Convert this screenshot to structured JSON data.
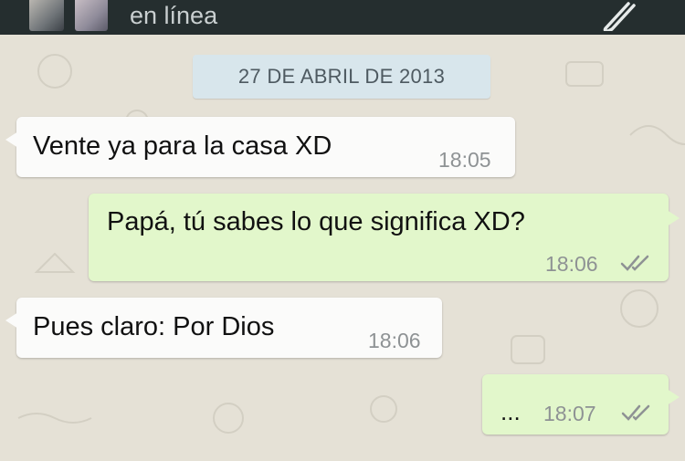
{
  "header": {
    "status": "en línea",
    "attach_icon": "paperclip-icon",
    "avatars": [
      "contact-avatar-photo",
      "contact-avatar-photo"
    ]
  },
  "chat": {
    "date_label": "27 DE ABRIL DE 2013",
    "messages": [
      {
        "direction": "incoming",
        "text": "Vente ya para la casa XD",
        "time": "18:05"
      },
      {
        "direction": "outgoing",
        "text": "Papá, tú sabes lo que significa XD?",
        "time": "18:06",
        "status_icon": "double-check-icon"
      },
      {
        "direction": "incoming",
        "text": "Pues claro: Por Dios",
        "time": "18:06"
      },
      {
        "direction": "outgoing",
        "text": "...",
        "time": "18:07",
        "status_icon": "double-check-icon"
      }
    ]
  },
  "colors": {
    "header_bg": "#252e2f",
    "wallpaper": "#e5e1d6",
    "incoming_bubble": "#fbfbfa",
    "outgoing_bubble": "#e2f7cb",
    "date_chip": "#d8e6ec"
  }
}
